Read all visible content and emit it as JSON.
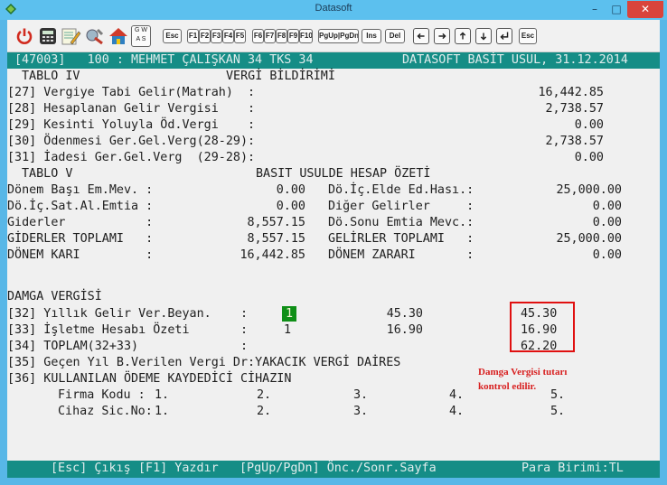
{
  "window": {
    "title": "Datasoft",
    "min_glyph": "–",
    "max_glyph": "□",
    "close_glyph": "✕"
  },
  "toolbar": {
    "keys": {
      "esc": "Esc",
      "f1": "F1",
      "f2": "F2",
      "f3": "F3",
      "f4": "F4",
      "f5": "F5",
      "f6": "F6",
      "f7": "F7",
      "f8": "F8",
      "f9": "F9",
      "f10": "F10",
      "pgup_pgdn": "PgUp|PgDn",
      "ins": "Ins",
      "del": "Del",
      "esc_right": "Esc",
      "gw": "G W",
      "as": "A S"
    }
  },
  "screen": {
    "header": {
      "left": "[47003]   100 : MEHMET ÇALIŞKAN 34 TKS 34",
      "right": "DATASOFT BASİT USUL, 31.12.2014"
    },
    "tablo4": {
      "label": "TABLO IV",
      "title": "VERGİ BİLDİRİMİ",
      "rows": [
        {
          "label": "[27] Vergiye Tabi Gelir(Matrah)  :",
          "value": "16,442.85"
        },
        {
          "label": "[28] Hesaplanan Gelir Vergisi    :",
          "value": "2,738.57"
        },
        {
          "label": "[29] Kesinti Yoluyla Öd.Vergi    :",
          "value": "0.00"
        },
        {
          "label": "[30] Ödenmesi Ger.Gel.Verg(28-29):",
          "value": "2,738.57"
        },
        {
          "label": "[31] İadesi Ger.Gel.Verg  (29-28):",
          "value": "0.00"
        }
      ]
    },
    "tablo5": {
      "label": "TABLO V",
      "title": "BASIT USULDE HESAP ÖZETİ",
      "rows": [
        {
          "l_label": "Dönem Başı Em.Mev. :",
          "l_value": "0.00",
          "r_label": "Dö.İç.Elde Ed.Hası.:",
          "r_value": "25,000.00"
        },
        {
          "l_label": "Dö.İç.Sat.Al.Emtia :",
          "l_value": "0.00",
          "r_label": "Diğer Gelirler     :",
          "r_value": "0.00"
        },
        {
          "l_label": "Giderler           :",
          "l_value": "8,557.15",
          "r_label": "Dö.Sonu Emtia Mevc.:",
          "r_value": "0.00"
        },
        {
          "l_label": "GİDERLER TOPLAMI   :",
          "l_value": "8,557.15",
          "r_label": "GELİRLER TOPLAMI   :",
          "r_value": "25,000.00"
        },
        {
          "l_label": "DÖNEM KARI         :",
          "l_value": "16,442.85",
          "r_label": "DÖNEM ZARARI       :",
          "r_value": "0.00"
        }
      ]
    },
    "damga": {
      "title": "DAMGA VERGİSİ",
      "rows": [
        {
          "label": "[32] Yıllık Gelir Ver.Beyan.    :",
          "count": "1",
          "unit": "45.30",
          "total": "45.30"
        },
        {
          "label": "[33] İşletme Hesabı Özeti       :",
          "count": "1",
          "unit": "16.90",
          "total": "16.90"
        },
        {
          "label": "[34] TOPLAM(32+33)              :",
          "count": "",
          "unit": "",
          "total": "62.20"
        }
      ]
    },
    "line35": "[35] Geçen Yıl B.Verilen Vergi Dr:YAKACIK VERGİ DAİRES",
    "line36": "[36] KULLANILAN ÖDEME KAYDEDİCİ CİHAZIN",
    "firma": {
      "label": "Firma Kodu :",
      "cols": [
        "1.",
        "2.",
        "3.",
        "4.",
        "5."
      ]
    },
    "cihaz": {
      "label": "Cihaz Sic.No:",
      "cols": [
        "1.",
        "2.",
        "3.",
        "4.",
        "5."
      ]
    },
    "footer": {
      "esc": "[Esc] Çıkış",
      "f1": "[F1] Yazdır",
      "pg": "[PgUp/PgDn] Önc./Sonr.Sayfa",
      "currency": "Para Birimi:TL"
    }
  },
  "annotation": {
    "line1": "Damga Vergisi tutarı",
    "line2": "kontrol edilir."
  }
}
